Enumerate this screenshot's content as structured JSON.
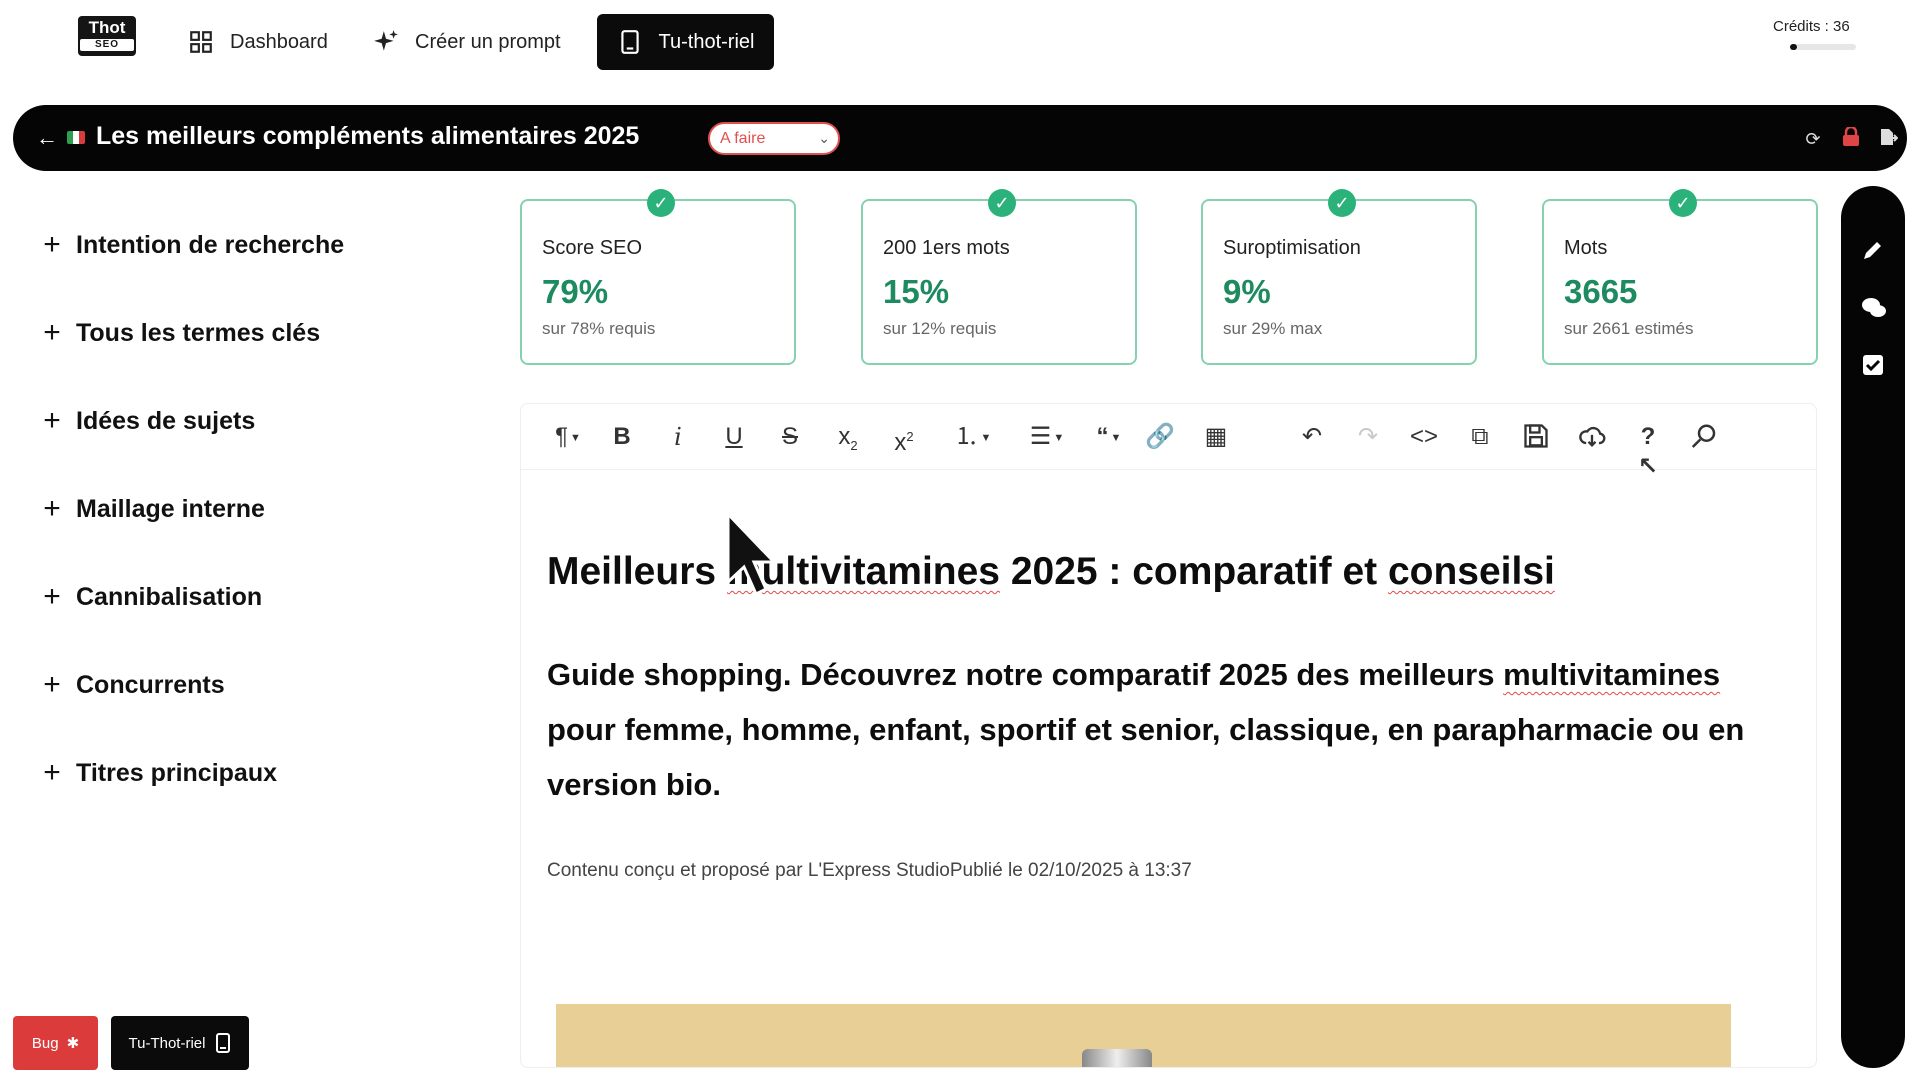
{
  "nav": {
    "logo_top": "Thot",
    "logo_bottom": "SEO",
    "dashboard": "Dashboard",
    "create_prompt": "Créer un prompt",
    "tutorial": "Tu-thot-riel",
    "credits_label": "Crédits : 36",
    "credits_fill": 0.1
  },
  "titlebar": {
    "title": "Les meilleurs compléments alimentaires 2025",
    "status": "A faire"
  },
  "sidebar": {
    "items": [
      {
        "label": "Intention de recherche"
      },
      {
        "label": "Tous les termes clés"
      },
      {
        "label": "Idées de sujets"
      },
      {
        "label": "Maillage interne"
      },
      {
        "label": "Cannibalisation"
      },
      {
        "label": "Concurrents"
      },
      {
        "label": "Titres principaux"
      }
    ]
  },
  "cards": [
    {
      "label": "Score SEO",
      "value": "79%",
      "sub": "sur 78% requis"
    },
    {
      "label": "200 1ers mots",
      "value": "15%",
      "sub": "sur 12% requis"
    },
    {
      "label": "Suroptimisation",
      "value": "9%",
      "sub": "sur 29% max"
    },
    {
      "label": "Mots",
      "value": "3665",
      "sub": "sur 2661 estimés"
    }
  ],
  "editor": {
    "h1_a": "Meilleurs ",
    "h1_b": "multivitamines",
    "h1_c": " 2025 : comparatif et ",
    "h1_d": "conseilsi",
    "h2_a": "Guide shopping. Découvrez notre comparatif 2025 des meilleurs ",
    "h2_b": "multivitamines",
    "h2_c": " pour femme, homme, enfant, sportif et senior, classique, en parapharmacie ou en version bio.",
    "meta": "Contenu conçu et proposé par L'Express StudioPublié le 02/10/2025 à 13:37"
  },
  "bottom": {
    "bug": "Bug",
    "tutorial": "Tu-Thot-riel"
  },
  "colors": {
    "accent_green": "#1d8a5f",
    "check_green": "#2bb27b",
    "status_red": "#e05050",
    "bug_red": "#dc3b3b"
  }
}
